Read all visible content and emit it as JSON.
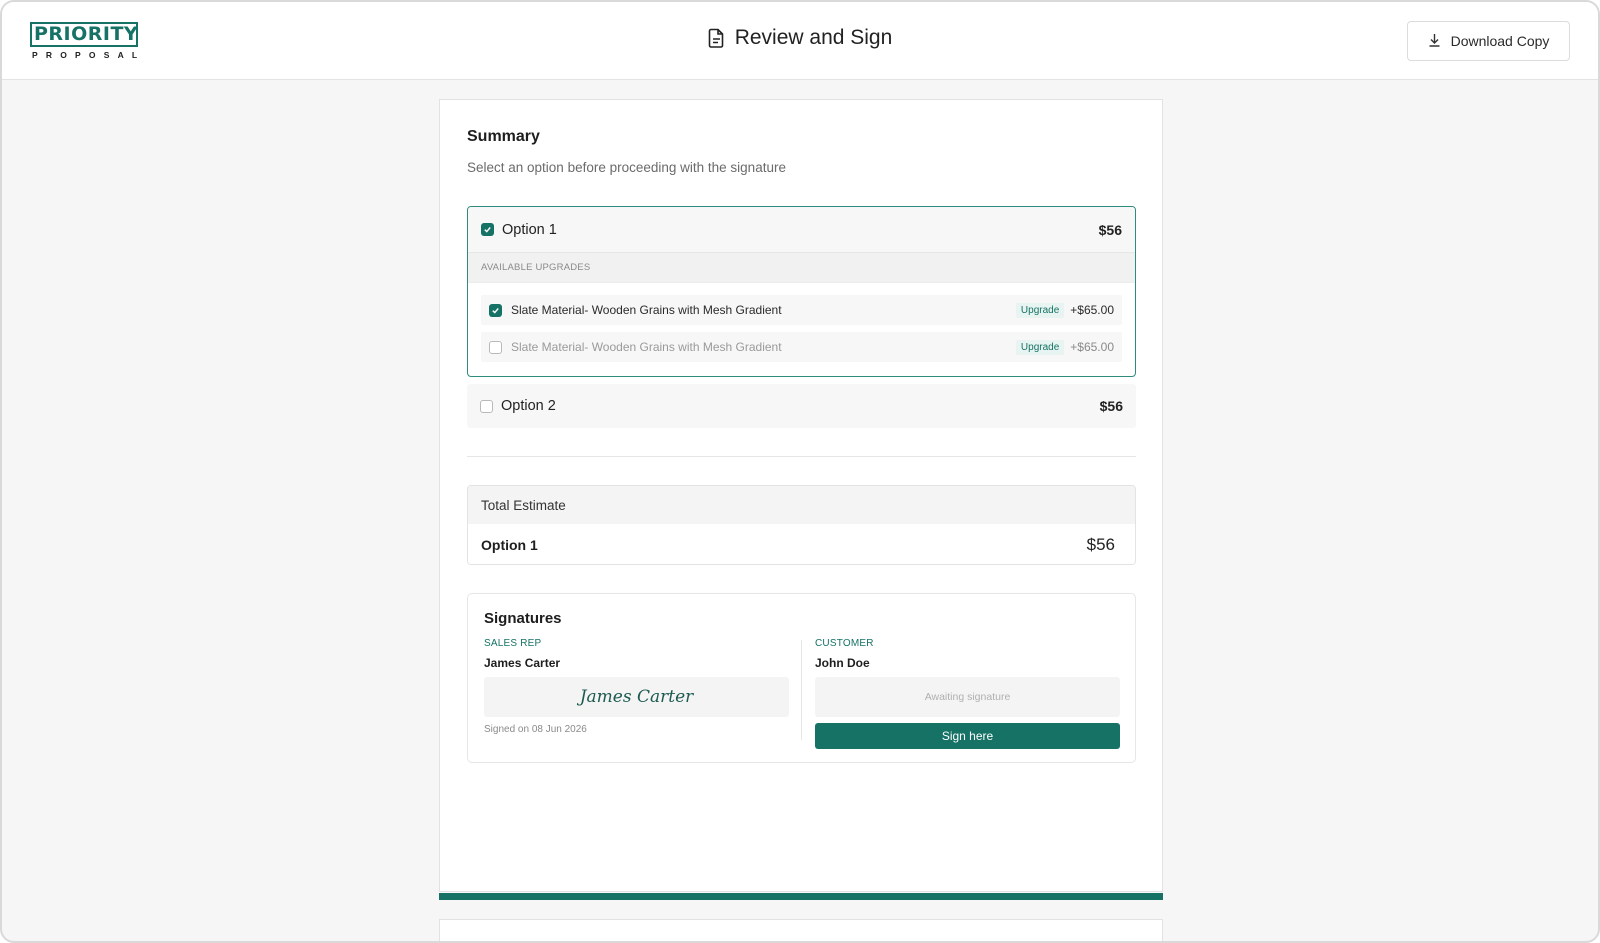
{
  "header": {
    "logo_main": "PRIORITY",
    "logo_sub": "PROPOSAL",
    "title": "Review and Sign",
    "download_label": "Download Copy"
  },
  "summary": {
    "title": "Summary",
    "subtitle": "Select an option before proceeding with the signature",
    "options": [
      {
        "label": "Option 1",
        "price": "$56",
        "checked": true,
        "upgrades_header": "AVAILABLE UPGRADES",
        "upgrades": [
          {
            "label": "Slate Material- Wooden Grains with Mesh Gradient",
            "badge": "Upgrade",
            "price": "+$65.00",
            "checked": true
          },
          {
            "label": "Slate Material- Wooden Grains with Mesh Gradient",
            "badge": "Upgrade",
            "price": "+$65.00",
            "checked": false
          }
        ]
      },
      {
        "label": "Option 2",
        "price": "$56",
        "checked": false
      }
    ]
  },
  "total": {
    "title": "Total Estimate",
    "option": "Option 1",
    "amount": "$56"
  },
  "signatures": {
    "title": "Signatures",
    "sales_rep": {
      "role": "SALES REP",
      "name": "James Carter",
      "signature": "James Carter",
      "signed_on": "Signed on 08 Jun 2026"
    },
    "customer": {
      "role": "CUSTOMER",
      "name": "John Doe",
      "placeholder": "Awaiting signature",
      "button": "Sign here"
    }
  },
  "colors": {
    "brand": "#157265",
    "background": "#f6f6f6"
  }
}
